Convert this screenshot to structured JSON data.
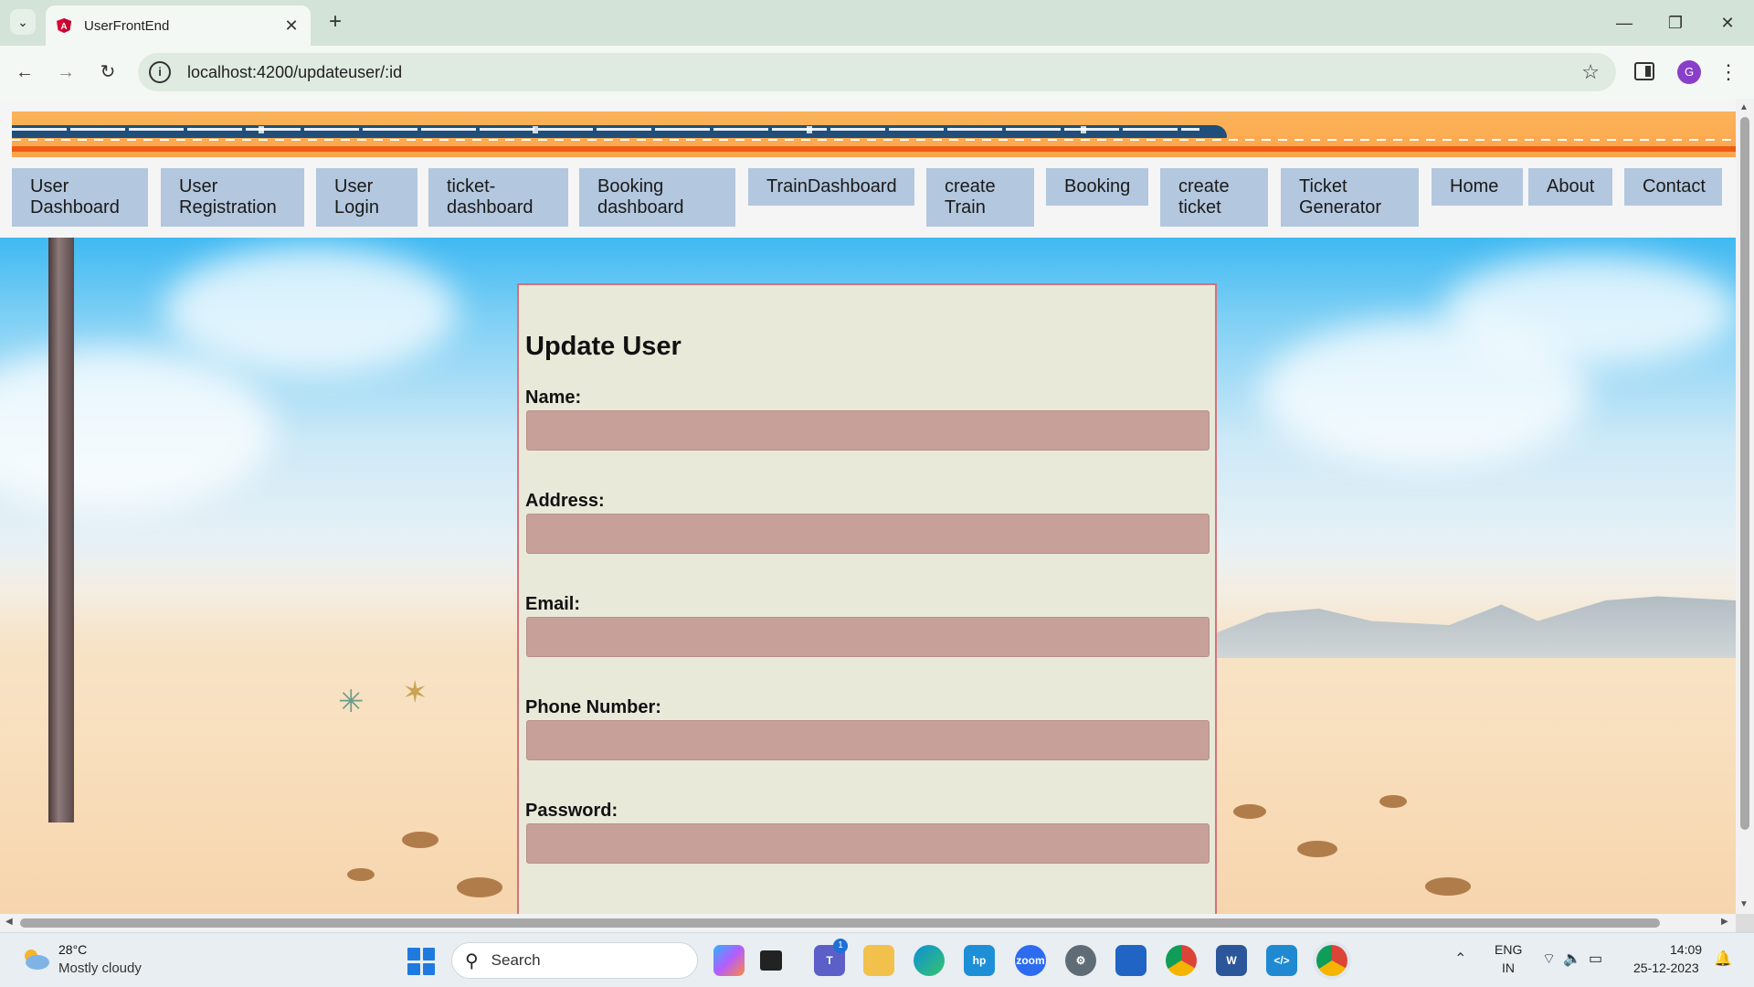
{
  "browser": {
    "tab_title": "UserFrontEnd",
    "tab_close": "✕",
    "new_tab": "+",
    "url": "localhost:4200/updateuser/:id",
    "profile_initial": "G",
    "window_controls": {
      "minimize": "—",
      "restore": "❐",
      "close": "✕"
    },
    "nav_buttons": {
      "back": "←",
      "forward": "→",
      "reload": "↻"
    }
  },
  "nav": {
    "items": [
      {
        "label": "User Dashboard"
      },
      {
        "label": "User Registration"
      },
      {
        "label": "User Login"
      },
      {
        "label": "ticket-dashboard"
      },
      {
        "label": "Booking dashboard"
      },
      {
        "label": "TrainDashboard"
      },
      {
        "label": "create Train"
      },
      {
        "label": "Booking"
      },
      {
        "label": "create ticket"
      },
      {
        "label": "Ticket Generator"
      },
      {
        "label": "Home"
      },
      {
        "label": "About"
      },
      {
        "label": "Contact"
      }
    ]
  },
  "form": {
    "title": "Update User",
    "fields": [
      {
        "label": "Name:",
        "value": ""
      },
      {
        "label": "Address:",
        "value": ""
      },
      {
        "label": "Email:",
        "value": ""
      },
      {
        "label": "Phone Number:",
        "value": ""
      },
      {
        "label": "Password:",
        "value": ""
      }
    ]
  },
  "taskbar": {
    "weather": {
      "temp": "28°C",
      "desc": "Mostly cloudy"
    },
    "search_label": "Search",
    "apps": [
      "copilot",
      "task-view",
      "teams",
      "file-explorer",
      "edge",
      "myhp",
      "zoom",
      "settings",
      "microsoft-store",
      "chrome",
      "word",
      "vscode",
      "chrome-profile"
    ],
    "teams_badge": "1",
    "language": {
      "line1": "ENG",
      "line2": "IN"
    },
    "time": "14:09",
    "date": "25-12-2023"
  },
  "colors": {
    "nav_button": "#b3c7de",
    "form_card": "#e8e9d9",
    "form_border": "#d6717a",
    "input_fill": "#c8a09a",
    "banner": "#fca54b"
  }
}
